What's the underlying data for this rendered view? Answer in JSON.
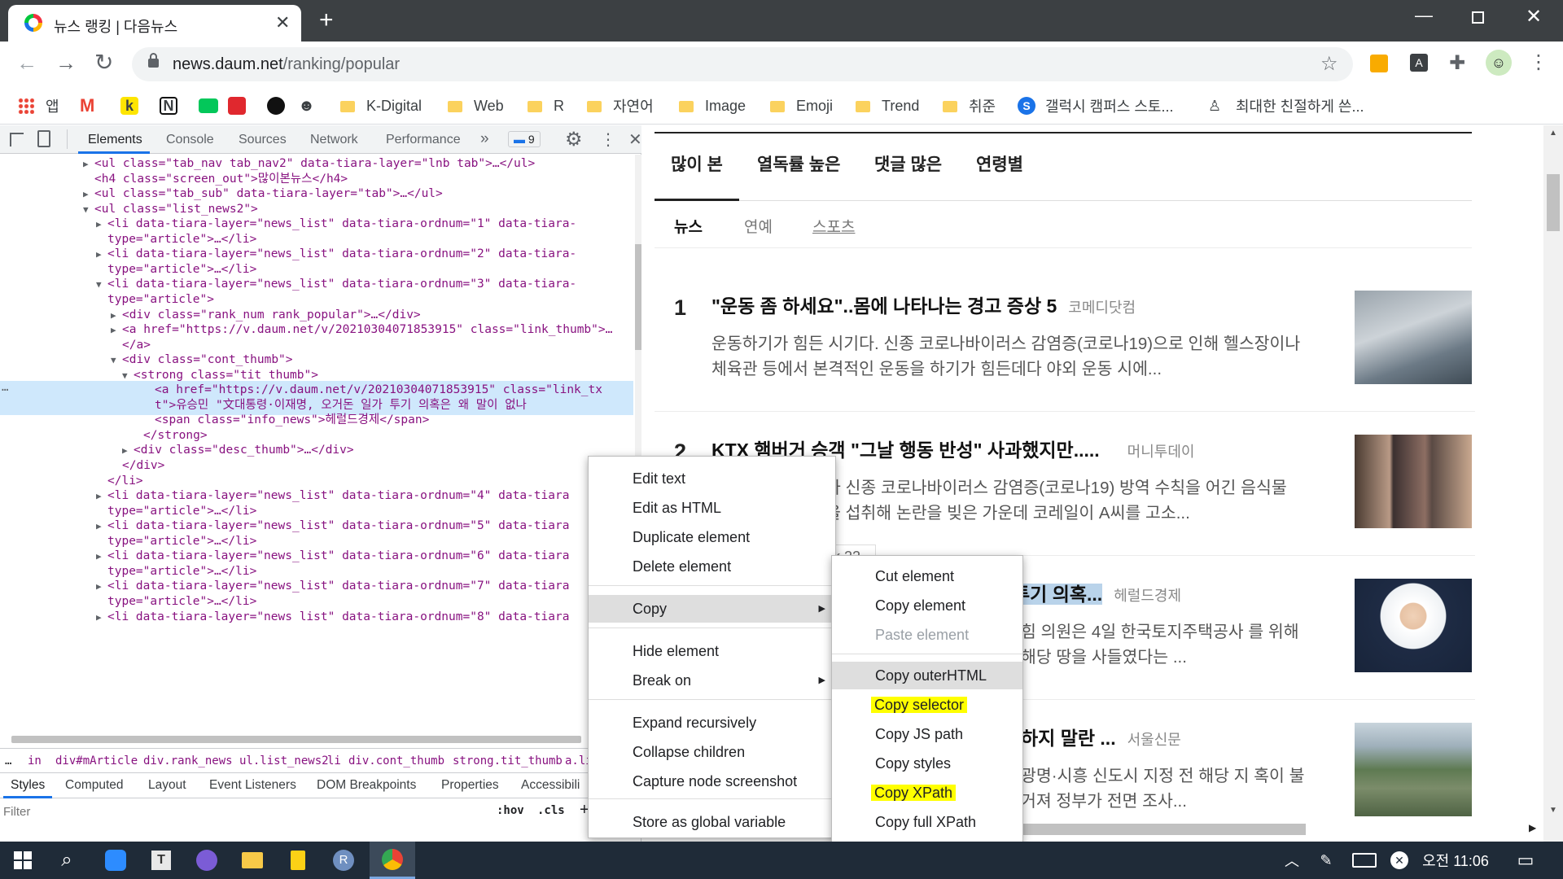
{
  "browser": {
    "tab_title": "뉴스 랭킹 | 다음뉴스",
    "address_domain": "news.daum.net",
    "address_path": "/ranking/popular"
  },
  "bookmarks": [
    {
      "label": "앱"
    },
    {
      "label": "K-Digital"
    },
    {
      "label": "Web"
    },
    {
      "label": "R"
    },
    {
      "label": "자연어"
    },
    {
      "label": "Image"
    },
    {
      "label": "Emoji"
    },
    {
      "label": "Trend"
    },
    {
      "label": "취준"
    },
    {
      "label": "갤럭시 캠퍼스 스토..."
    },
    {
      "label": "최대한 친절하게 쓴..."
    }
  ],
  "devtools": {
    "tabs": [
      "Elements",
      "Console",
      "Sources",
      "Network",
      "Performance"
    ],
    "more": "»",
    "issues_count": "9",
    "lines": [
      {
        "t": "<ul class=\"tab_nav tab_nav2\" data-tiara-layer=\"lnb tab\">…</ul>"
      },
      {
        "t": "<h4 class=\"screen_out\">많이본뉴스</h4>"
      },
      {
        "t": "<ul class=\"tab_sub\" data-tiara-layer=\"tab\">…</ul>"
      },
      {
        "t": "<ul class=\"list_news2\">"
      },
      {
        "t": "<li data-tiara-layer=\"news_list\" data-tiara-ordnum=\"1\" data-tiara-"
      },
      {
        "t": "type=\"article\">…</li>"
      },
      {
        "t": "<li data-tiara-layer=\"news_list\" data-tiara-ordnum=\"2\" data-tiara-"
      },
      {
        "t": "type=\"article\">…</li>"
      },
      {
        "t": "<li data-tiara-layer=\"news_list\" data-tiara-ordnum=\"3\" data-tiara-"
      },
      {
        "t": "type=\"article\">"
      },
      {
        "t": "<div class=\"rank_num rank_popular\">…</div>"
      },
      {
        "t": "<a href=\"https://v.daum.net/v/20210304071853915\" class=\"link_thumb\">…"
      },
      {
        "t": "</a>"
      },
      {
        "t": "<div class=\"cont_thumb\">"
      },
      {
        "t": "<strong class=\"tit_thumb\">"
      },
      {
        "t": "<a href=\"https://v.daum.net/v/20210304071853915\" class=\"link_tx"
      },
      {
        "t": "t\">유승민 \"文대통령·이재명, 오거돈 일가 투기 의혹은 왜 말이 없나"
      },
      {
        "t": "<span class=\"info_news\">헤럴드경제</span>"
      },
      {
        "t": "</strong>"
      },
      {
        "t": "<div class=\"desc_thumb\">…</div>"
      },
      {
        "t": "</div>"
      },
      {
        "t": "</li>"
      },
      {
        "t": "<li data-tiara-layer=\"news_list\" data-tiara-ordnum=\"4\" data-tiara"
      },
      {
        "t": "type=\"article\">…</li>"
      },
      {
        "t": "<li data-tiara-layer=\"news_list\" data-tiara-ordnum=\"5\" data-tiara"
      },
      {
        "t": "type=\"article\">…</li>"
      },
      {
        "t": "<li data-tiara-layer=\"news_list\" data-tiara-ordnum=\"6\" data-tiara"
      },
      {
        "t": "type=\"article\">…</li>"
      },
      {
        "t": "<li data-tiara-layer=\"news_list\" data-tiara-ordnum=\"7\" data-tiara"
      },
      {
        "t": "type=\"article\">…</li>"
      },
      {
        "t": "<li data-tiara-layer=\"news list\" data-tiara-ordnum=\"8\" data-tiara"
      }
    ],
    "breadcrumbs": [
      "…",
      "in",
      "div#mArticle",
      "div.rank_news",
      "ul.list_news2",
      "li",
      "div.cont_thumb",
      "strong.tit_thumb",
      "a.lir"
    ],
    "sub_tabs": [
      "Styles",
      "Computed",
      "Layout",
      "Event Listeners",
      "DOM Breakpoints",
      "Properties",
      "Accessibili"
    ],
    "filter_placeholder": "Filter",
    "hov": ":hov",
    "cls": ".cls",
    "plus": "+"
  },
  "page": {
    "rank_tabs": [
      "많이 본",
      "열독률 높은",
      "댓글 많은",
      "연령별"
    ],
    "sub_tabs": [
      "뉴스",
      "연예",
      "스포츠"
    ],
    "items": [
      {
        "rank": "1",
        "title": "\"운동 좀 하세요\"..몸에 나타나는 경고 증상 5",
        "source": "코메디닷컴",
        "desc": "운동하기가 힘든 시기다. 신종 코로나바이러스 감염증(코로나19)으로 인해 헬스장이나 체육관 등에서 본격적인 운동을 하기가 힘든데다 야외 운동 시에..."
      },
      {
        "rank": "2",
        "title": "KTX 햄버거 승객 \"그날 행동 반성\" 사과했지만.....",
        "source": "머니투데이",
        "desc": "가 신종 코로나바이러스 감염증(코로나19) 방역 수칙을 어긴 음식물을 섭취해 논란을 빚은 가운데 코레일이 A씨를 고소..."
      },
      {
        "rank": "",
        "title": "투기 의혹...",
        "source": "헤럴드경제",
        "desc": "힘 의원은 4일 한국토지주택공사 를 위해 해당 땅을 사들였다는 ..."
      },
      {
        "rank": "",
        "title": "하지 말란 ...",
        "source": "서울신문",
        "desc": "광명·시흥 신도시 지정 전 해당 지 혹이 불거져 정부가 전면 조사..."
      }
    ],
    "tooltip_count": "k 22"
  },
  "context_menu": {
    "items": [
      "Edit text",
      "Edit as HTML",
      "Duplicate element",
      "Delete element",
      "Copy",
      "Hide element",
      "Break on",
      "Expand recursively",
      "Collapse children",
      "Capture node screenshot",
      "Store as global variable"
    ]
  },
  "copy_submenu": {
    "items": [
      "Cut element",
      "Copy element",
      "Paste element",
      "Copy outerHTML",
      "Copy selector",
      "Copy JS path",
      "Copy styles",
      "Copy XPath",
      "Copy full XPath"
    ]
  },
  "taskbar": {
    "time": "오전 11:06"
  },
  "colors": {
    "highlight": "#ffff00",
    "tabbar": "#3c4043",
    "taskbar": "#1f2b38"
  }
}
